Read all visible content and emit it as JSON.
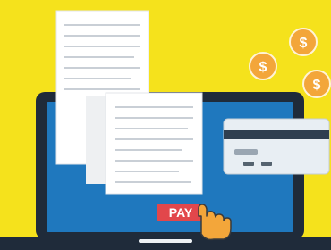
{
  "scene": {
    "background_color": "#f5e21c",
    "laptop": {
      "frame_color": "#1f2b3a",
      "screen_color": "#1f78be"
    },
    "invoice": {
      "paper_color": "#ffffff",
      "line_color": "#c9cfd6"
    },
    "card": {
      "body_color": "#e8eef3",
      "stripe_color": "#2f3f50"
    },
    "coins": {
      "count": 3,
      "color": "#f3a63a",
      "symbol": "$"
    },
    "pay_button": {
      "label": "PAY",
      "color": "#e2474b"
    },
    "icons": [
      "laptop-icon",
      "invoice-icon",
      "credit-card-icon",
      "coin-icon",
      "cursor-hand-icon"
    ]
  }
}
